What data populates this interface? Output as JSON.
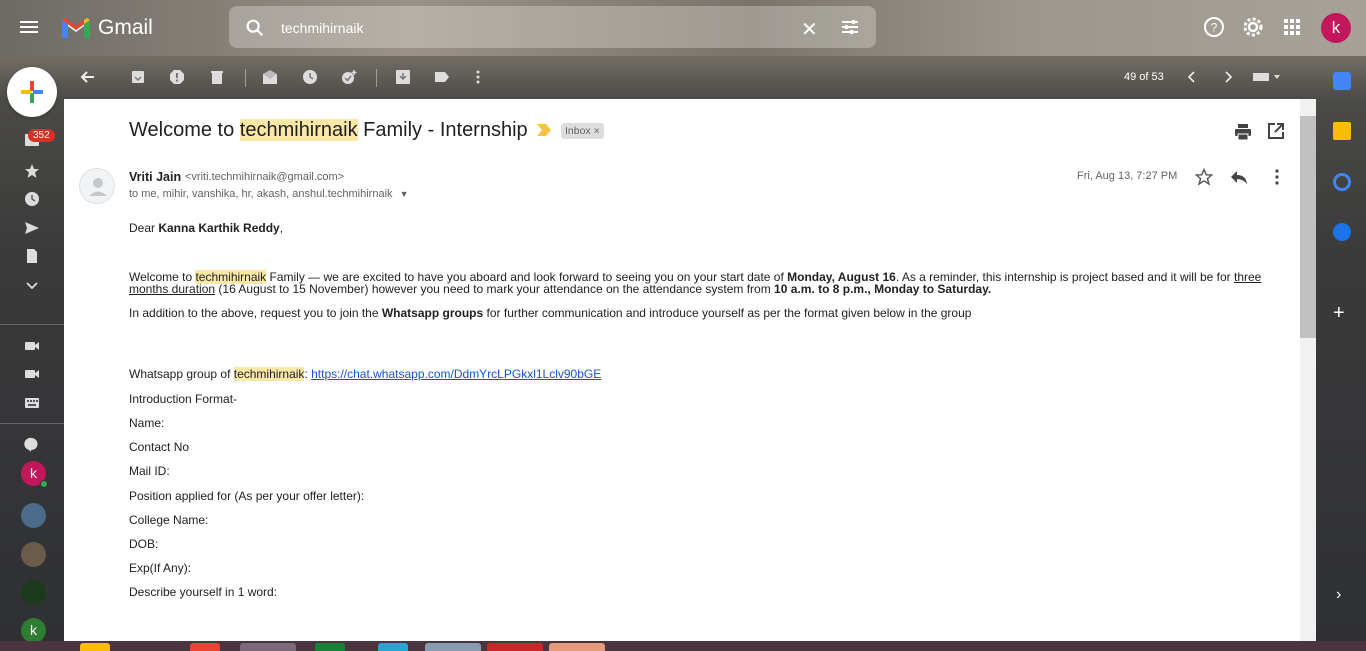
{
  "app": {
    "name": "Gmail"
  },
  "search": {
    "value": "techmihirnaik"
  },
  "top_right": {
    "avatar_letter": "k"
  },
  "toolbar": {
    "page_count": "49 of 53"
  },
  "nav": {
    "badge": "352"
  },
  "contacts": [
    {
      "letter": "k",
      "color": "#c2185b"
    },
    {
      "letter": "k",
      "color": "#2e7d32"
    }
  ],
  "email": {
    "subject_prefix": "Welcome to ",
    "subject_highlight": "techmihirnaik",
    "subject_suffix": " Family - Internship",
    "label": "Inbox",
    "sender_name": "Vriti Jain",
    "sender_email": "<vriti.techmihirnaik@gmail.com>",
    "recipients": "to me, mihir, vanshika, hr, akash, anshul.techmihirnaik",
    "date": "Fri, Aug 13, 7:27 PM",
    "greeting_prefix": "Dear ",
    "greeting_name": "Kanna Karthik Reddy",
    "greeting_suffix": ",",
    "p1_a": "Welcome to ",
    "p1_hl": "techmihirnaik",
    "p1_b": " Family — we are excited to have you aboard and look forward to seeing you on your start date of ",
    "p1_bold1": "Monday, August 16",
    "p1_c": ". As a reminder, this internship is project based and it will be for ",
    "p1_u": "three months duration",
    "p1_d": " (16 August to 15 November) however you need to mark your attendance on the attendance system from ",
    "p1_bold2": "10 a.m. to 8 p.m., Monday to Saturday.",
    "p2_a": "In addition to the above, request you to join the ",
    "p2_bold": "Whatsapp groups",
    "p2_b": " for further communication and introduce yourself as per the format given below in the group",
    "wa_a": "Whatsapp group of ",
    "wa_hl": "techmihirnaik",
    "wa_b": ": ",
    "wa_link": "https://chat.whatsapp.com/DdmYrcLPGkxl1Lclv90bGE",
    "format_title": "Introduction Format-",
    "fields": [
      "Name:",
      "Contact No",
      "Mail ID:",
      "Position applied for (As per your offer letter):",
      "College Name:",
      "DOB:",
      "Exp(If Any):",
      "Describe yourself in 1 word:"
    ]
  }
}
